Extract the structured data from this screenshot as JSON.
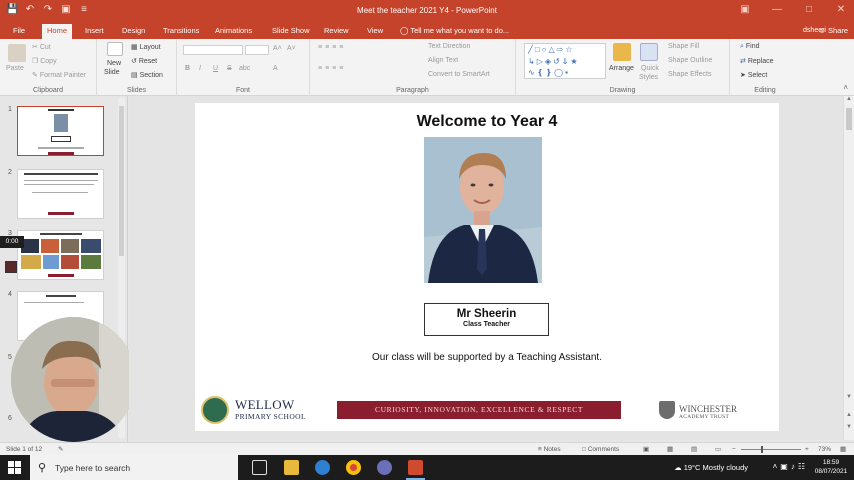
{
  "window": {
    "title": "Meet the teacher 2021 Y4 - PowerPoint",
    "user": "dsheeri",
    "share_label": "Share"
  },
  "tabs": [
    "File",
    "Home",
    "Insert",
    "Design",
    "Transitions",
    "Animations",
    "Slide Show",
    "Review",
    "View"
  ],
  "active_tab": "Home",
  "tell_me": "Tell me what you want to do...",
  "ribbon": {
    "clipboard": {
      "label": "Clipboard",
      "paste": "Paste",
      "cut": "Cut",
      "copy": "Copy",
      "format_painter": "Format Painter"
    },
    "slides": {
      "label": "Slides",
      "new_slide": "New",
      "new_slide2": "Slide",
      "layout": "Layout",
      "reset": "Reset",
      "section": "Section"
    },
    "font": {
      "label": "Font",
      "bold": "B",
      "italic": "I",
      "underline": "U",
      "strike": "S",
      "shadow": "abc"
    },
    "paragraph": {
      "label": "Paragraph",
      "text_direction": "Text Direction",
      "align_text": "Align Text",
      "convert": "Convert to SmartArt"
    },
    "drawing": {
      "label": "Drawing",
      "arrange": "Arrange",
      "quick_styles": "Quick",
      "quick_styles2": "Styles",
      "shape_fill": "Shape Fill",
      "shape_outline": "Shape Outline",
      "shape_effects": "Shape Effects"
    },
    "editing": {
      "label": "Editing",
      "find": "Find",
      "replace": "Replace",
      "select": "Select"
    }
  },
  "thumbnails": {
    "numbers": [
      "1",
      "2",
      "3",
      "4",
      "5",
      "6"
    ],
    "timer": "0:00"
  },
  "slide": {
    "title": "Welcome to Year 4",
    "teacher_name": "Mr Sheerin",
    "teacher_role": "Class Teacher",
    "support_text": "Our class will be supported by a Teaching Assistant.",
    "school_name": "WELLOW",
    "school_sub": "PRIMARY SCHOOL",
    "motto": "CURIOSITY, INNOVATION, EXCELLENCE & RESPECT",
    "trust_line1": "WINCHESTER",
    "trust_line2": "ACADEMY TRUST"
  },
  "statusbar": {
    "slide_count": "Slide 1 of 12",
    "notes": "Notes",
    "comments": "Comments",
    "zoom": "73%"
  },
  "taskbar": {
    "search_placeholder": "Type here to search",
    "weather": "19°C  Mostly cloudy",
    "time": "18:59",
    "date": "08/07/2021"
  },
  "colors": {
    "accent": "#c5432b",
    "motto_band": "#8b1e2e",
    "taskbar": "#1c1c1c"
  }
}
